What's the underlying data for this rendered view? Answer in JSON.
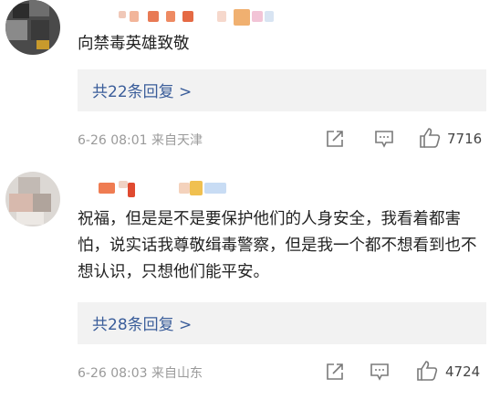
{
  "comments": [
    {
      "text": "向禁毒英雄致敬",
      "replies_label": "共22条回复 >",
      "date": "6-26 08:01",
      "location": "来自天津",
      "like_count": "7716"
    },
    {
      "text": "祝福，但是是不是要保护他们的人身安全，我看着都害怕，说实话我尊敬缉毒警察，但是我一个都不想看到也不想认识，只想他们能平安。",
      "replies_label": "共28条回复 >",
      "date": "6-26 08:03",
      "location": "来自山东",
      "like_count": "4724"
    }
  ],
  "colors": {
    "link": "#3a5d9a",
    "meta": "#9a9a9a",
    "reply_bg": "#f2f2f2"
  },
  "icons": [
    "share-icon",
    "comment-icon",
    "like-icon"
  ]
}
